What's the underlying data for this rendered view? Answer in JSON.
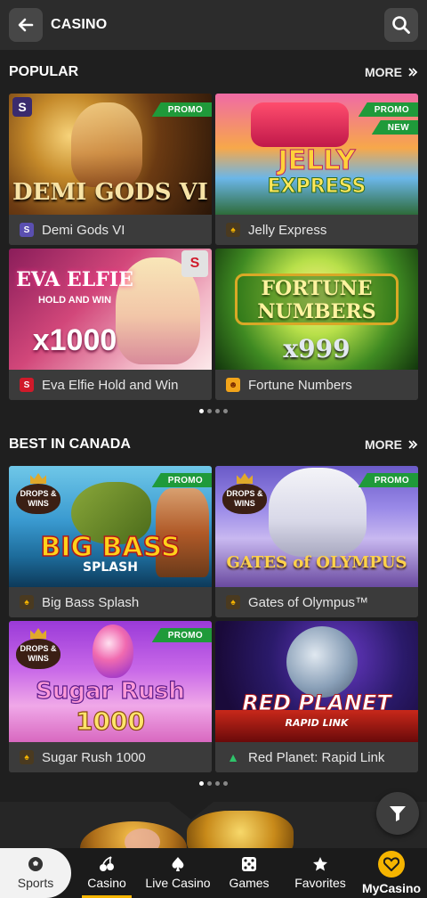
{
  "header": {
    "title": "CASINO",
    "back_icon": "back-arrow-icon",
    "search_icon": "search-icon"
  },
  "sections": [
    {
      "title": "POPULAR",
      "more_label": "MORE",
      "games": [
        {
          "name": "Demi Gods VI",
          "art_title": "DEMI GODS VI",
          "badges": [
            "PROMO"
          ],
          "provider": "spinomenal"
        },
        {
          "name": "Jelly Express",
          "art_title": "JELLY EXPRESS",
          "badges": [
            "PROMO",
            "NEW"
          ],
          "provider": "pragmatic"
        },
        {
          "name": "Eva Elfie Hold and Win",
          "art_title": "EVA ELFIE",
          "art_subtitle": "HOLD AND WIN",
          "art_extra": "x1000",
          "badges": [],
          "provider": "spinomenal-red"
        },
        {
          "name": "Fortune Numbers",
          "art_title": "FORTUNE NUMBERS",
          "art_extra": "x999",
          "badges": [],
          "provider": "bgaming"
        }
      ],
      "dots_total": 4,
      "dots_active": 0
    },
    {
      "title": "BEST IN CANADA",
      "more_label": "MORE",
      "games": [
        {
          "name": "Big Bass Splash",
          "art_title": "BIG BASS",
          "art_subtitle": "SPLASH",
          "badges": [
            "PROMO"
          ],
          "drops_wins": "DROPS & WINS",
          "provider": "pragmatic"
        },
        {
          "name": "Gates of Olympus™",
          "art_title": "GATES of OLYMPUS",
          "badges": [
            "PROMO"
          ],
          "drops_wins": "DROPS & WINS",
          "provider": "pragmatic"
        },
        {
          "name": "Sugar Rush 1000",
          "art_title": "Sugar Rush",
          "art_subtitle": "1000",
          "badges": [
            "PROMO"
          ],
          "drops_wins": "DROPS & WINS",
          "provider": "pragmatic"
        },
        {
          "name": "Red Planet: Rapid Link",
          "art_title": "RED PLANET",
          "art_subtitle": "RAPID LINK",
          "badges": [],
          "provider": "green"
        }
      ],
      "dots_total": 4,
      "dots_active": 0
    }
  ],
  "bottom_nav": [
    {
      "label": "Sports",
      "icon": "soccer-ball-icon",
      "active": false
    },
    {
      "label": "Casino",
      "icon": "cherries-icon",
      "active": true
    },
    {
      "label": "Live Casino",
      "icon": "spade-icon",
      "active": false
    },
    {
      "label": "Games",
      "icon": "dice-icon",
      "active": false
    },
    {
      "label": "Favorites",
      "icon": "star-icon",
      "active": false
    },
    {
      "label": "MyCasino",
      "icon": "heart-icon",
      "active": false
    }
  ],
  "colors": {
    "accent": "#f5b400",
    "promo_badge": "#1f9a3a",
    "background": "#1f1f1f",
    "header": "#2c2c2c"
  }
}
